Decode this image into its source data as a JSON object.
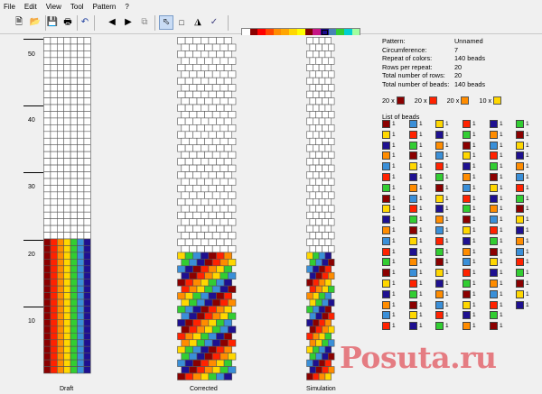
{
  "menu": [
    "File",
    "Edit",
    "View",
    "Tool",
    "Pattern",
    "?"
  ],
  "toolbar": {
    "icons": [
      "new-icon",
      "open-icon",
      "save-icon",
      "print-icon",
      "undo-icon",
      "arrow-left-icon",
      "arrow-right-icon",
      "copy-icon",
      "pointer-icon",
      "select-rect-icon",
      "fill-icon",
      "pipette-icon"
    ]
  },
  "palette": {
    "colors": [
      "#ffffff",
      "#8b0000",
      "#ff0000",
      "#ff4500",
      "#ff8c00",
      "#ffa500",
      "#ffd700",
      "#ffff00",
      "#800000",
      "#c71585",
      "#1a0a8c",
      "#4682b4",
      "#32cd32",
      "#00ced1",
      "#a0ffa0",
      "#40c8c8",
      "#00a0a0",
      "#40e0d0",
      "#9370db",
      "#ff66cc",
      "#ff69b4",
      "#ff99cc",
      "#cc99ff",
      "#c0c0c0",
      "#808080",
      "#555555",
      "#d3d3d3",
      "#e8e8e8",
      "#303030",
      "#000000"
    ]
  },
  "ruler": {
    "labels": [
      "50",
      "40",
      "30",
      "20",
      "10"
    ]
  },
  "views": {
    "draft": "Draft",
    "corrected": "Corrected",
    "simulation": "Simulation"
  },
  "info": {
    "pattern_label": "Pattern:",
    "pattern": "Unnamed",
    "circumference_label": "Circumference:",
    "circumference": "7",
    "repeat_label": "Repeat of colors:",
    "repeat": "140 beads",
    "rows_label": "Rows per repeat:",
    "rows": "20",
    "total_rows_label": "Total number of rows:",
    "total_rows": "20",
    "total_beads_label": "Total number of beads:",
    "total_beads": "140 beads"
  },
  "summary": [
    {
      "count": "20 x",
      "color": "#8b0000"
    },
    {
      "count": "20 x",
      "color": "#ff2200"
    },
    {
      "count": "20 x",
      "color": "#ff8c00"
    },
    {
      "count": "10 x",
      "color": "#ffd700"
    }
  ],
  "list_label": "List of beads",
  "bead_count": "1",
  "rainbow": [
    "#8b0000",
    "#ff2200",
    "#ff8c00",
    "#ffd700",
    "#32cd32",
    "#3a8fd8",
    "#1e1090"
  ],
  "watermark": "Posuta.ru"
}
